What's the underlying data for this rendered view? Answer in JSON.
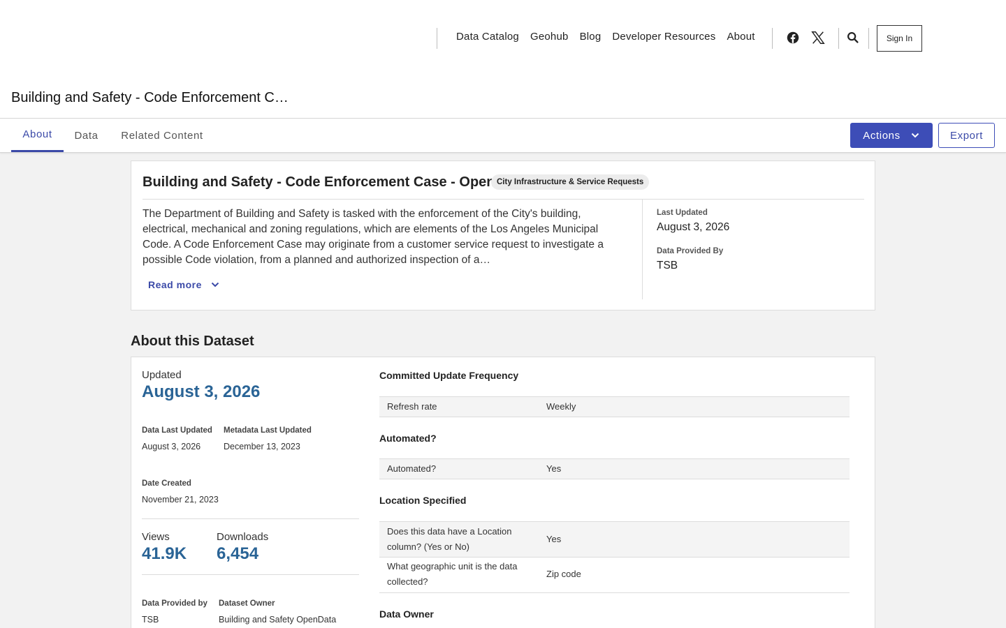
{
  "nav": {
    "links": [
      "Data Catalog",
      "Geohub",
      "Blog",
      "Developer Resources",
      "About"
    ],
    "sign_in": "Sign In"
  },
  "icons": {
    "facebook": "facebook-icon",
    "x": "x-twitter-icon",
    "search": "search-icon",
    "chevron": "chevron-down-icon"
  },
  "header": {
    "title": "Building and Safety - Code Enforcement Case - Open (N)"
  },
  "tabs": [
    {
      "label": "About",
      "active": true
    },
    {
      "label": "Data",
      "active": false
    },
    {
      "label": "Related Content",
      "active": false
    }
  ],
  "toolbar": {
    "actions_label": "Actions",
    "export_label": "Export"
  },
  "colors": {
    "accent": "#3d4db7",
    "stat_blue": "#2a6496"
  },
  "summary": {
    "title": "Building and Safety - Code Enforcement Case - Open (N)",
    "tag": "City Infrastructure & Service Requests",
    "description": "The Department of Building and Safety is tasked with the enforcement of the City's building, electrical, mechanical and zoning regulations, which are elements of the Los Angeles Municipal Code. A Code Enforcement Case may originate from a customer service request to investigate a possible Code violation, from a planned and authorized inspection of a…",
    "read_more": "Read more",
    "last_updated_label": "Last Updated",
    "last_updated": "August 3, 2026",
    "provided_by_label": "Data Provided By",
    "provided_by": "TSB"
  },
  "about": {
    "heading": "About this Dataset",
    "updated_label": "Updated",
    "updated": "August 3, 2026",
    "data_last_updated_label": "Data Last Updated",
    "data_last_updated": "August 3, 2026",
    "metadata_last_updated_label": "Metadata Last Updated",
    "metadata_last_updated": "December 13, 2023",
    "date_created_label": "Date Created",
    "date_created": "November 21, 2023",
    "views_label": "Views",
    "views": "41.9K",
    "downloads_label": "Downloads",
    "downloads": "6,454",
    "provided_by_label": "Data Provided by",
    "provided_by": "TSB",
    "owner_label": "Dataset Owner",
    "owner": "Building and Safety OpenData"
  },
  "metadata": {
    "frequency_heading": "Committed Update Frequency",
    "refresh_key": "Refresh rate",
    "refresh_val": "Weekly",
    "automated_heading": "Automated?",
    "automated_key": "Automated?",
    "automated_val": "Yes",
    "location_heading": "Location Specified",
    "location_key": "Does this data have a Location column? (Yes or No)",
    "location_val": "Yes",
    "geo_key": "What geographic unit is the data collected?",
    "geo_val": "Zip code",
    "owner_heading": "Data Owner"
  }
}
